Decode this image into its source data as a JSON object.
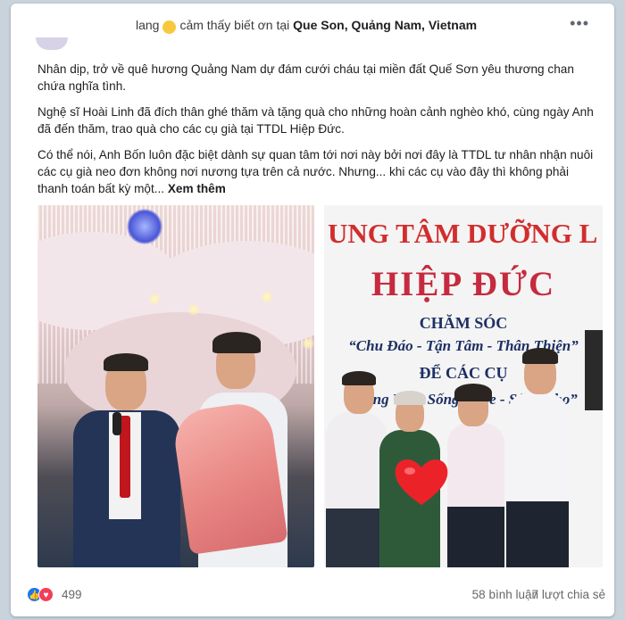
{
  "post": {
    "header_name_fragment": "lang",
    "header_feeling": "cảm thấy biết ơn tại",
    "header_location": "Que Son, Quảng Nam, Vietnam",
    "more_label": "•••",
    "paragraphs": [
      "Nhân dịp, trở về quê hương Quảng Nam dự đám cưới cháu  tại miền đất Quế Sơn yêu thương chan chứa nghĩa tình.",
      "Nghệ sĩ Hoài Linh đã đích thân ghé thăm và tặng quà cho những hoàn cảnh nghèo khó, cùng ngày Anh đã đến thăm, trao quà cho các cụ già tại TTDL Hiệp Đức.",
      "Có thể nói, Anh Bốn luôn đặc biệt dành sự quan tâm tới nơi này bởi nơi đây là TTDL tư nhân nhận nuôi các cụ già neo đơn không nơi nương tựa trên cả nước. Nhưng... khi các cụ vào đây thì không phải thanh toán bất kỳ một..."
    ],
    "see_more": "Xem thêm"
  },
  "photo_right_sign": {
    "line1": "UNG TÂM DƯỠNG L",
    "line2": "HIỆP ĐỨC",
    "line3": "CHĂM SÓC",
    "line4": "“Chu Đáo - Tận Tâm - Thân Thiện”",
    "line5": "ĐỂ CÁC CỤ",
    "line6": "“Sống Vui - Sống Khỏe - Sống Thọ”"
  },
  "footer": {
    "reaction_count": "499",
    "comments": "58 bình luận",
    "shares": "7 lượt chia sẻ"
  },
  "icons": {
    "like": "like-icon",
    "love": "love-icon",
    "feeling": "smiling-face-icon",
    "more": "more-dots-icon",
    "heart": "heart-icon"
  },
  "colors": {
    "like_blue": "#1877f2",
    "love_red": "#f33e58",
    "sign_red": "#d22d2d",
    "sign_navy": "#1d2f63"
  }
}
